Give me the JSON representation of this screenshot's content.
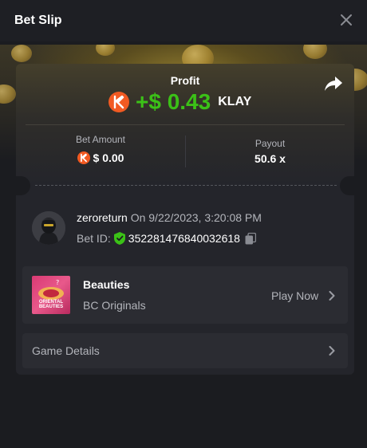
{
  "header": {
    "title": "Bet Slip",
    "close_icon": "close-icon"
  },
  "profit": {
    "label": "Profit",
    "value": "+$ 0.43",
    "currency": "KLAY",
    "value_color": "#3bc117",
    "coin_icon": "klay-coin-icon",
    "share_icon": "share-icon"
  },
  "bet_amount": {
    "label": "Bet Amount",
    "value": "$ 0.00"
  },
  "payout": {
    "label": "Payout",
    "value": "50.6 x"
  },
  "bet_info": {
    "username": "zeroreturn",
    "on_text": "On 9/22/2023, 3:20:08 PM",
    "bet_id_label": "Bet ID:",
    "bet_id": "352281476840032618",
    "verified_icon": "shield-check-icon",
    "copy_icon": "copy-icon"
  },
  "game": {
    "name": "Beauties",
    "provider": "BC Originals",
    "thumbnail_text": "ORIENTAL BEAUTIES",
    "play_label": "Play Now"
  },
  "game_details": {
    "label": "Game Details"
  },
  "colors": {
    "accent_green": "#3bc117",
    "klay_orange": "#f15a22",
    "card_bg": "#24252b",
    "page_bg": "#1b1c20"
  }
}
